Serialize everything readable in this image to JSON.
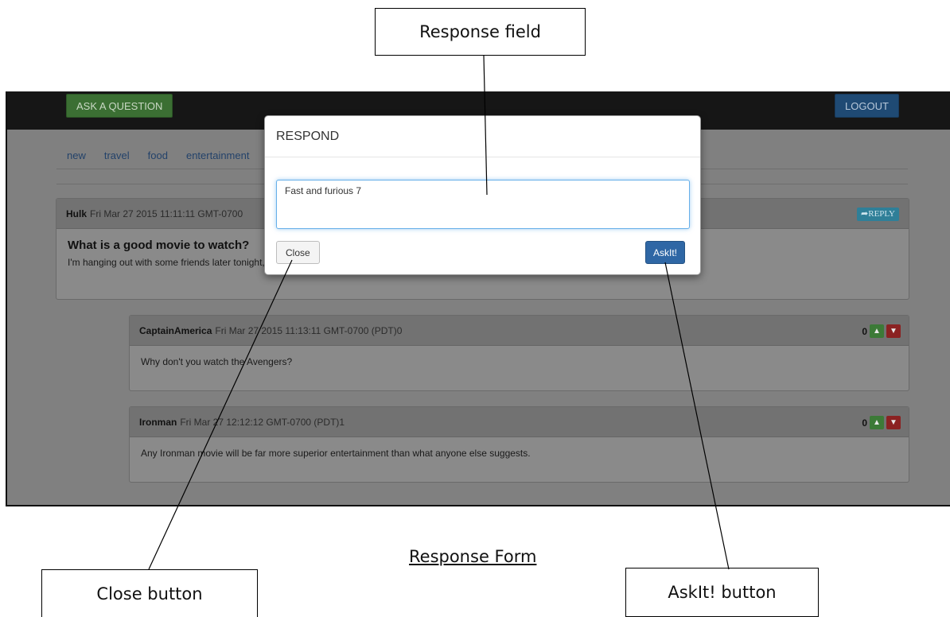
{
  "annotations": {
    "response_field": "Response field",
    "close_button": "Close button",
    "askit_button": "AskIt! button",
    "caption": "Response Form"
  },
  "navbar": {
    "ask_label": "ASK A QUESTION",
    "logout_label": "LOGOUT"
  },
  "categories": [
    "new",
    "travel",
    "food",
    "entertainment"
  ],
  "question": {
    "author": "Hulk",
    "timestamp": "Fri Mar 27 2015 11:11:11 GMT-0700",
    "reply_label": "REPLY",
    "title": "What is a good movie to watch?",
    "body": "I'm hanging out with some friends later tonight, what is a good entertaining action movie to watch?"
  },
  "answers": [
    {
      "author": "CaptainAmerica",
      "timestamp": "Fri Mar 27 2015 11:13:11 GMT-0700 (PDT)0",
      "votes": "0",
      "body": "Why don't you watch the Avengers?"
    },
    {
      "author": "Ironman",
      "timestamp": "Fri Mar 27 12:12:12 GMT-0700 (PDT)1",
      "votes": "0",
      "body": "Any Ironman movie will be far more superior entertainment than what anyone else suggests."
    }
  ],
  "modal": {
    "title": "RESPOND",
    "response_value": "Fast and furious 7",
    "close_label": "Close",
    "askit_label": "AskIt!"
  },
  "colors": {
    "ask_green": "#3b6f33",
    "logout_blue": "#1f4a74",
    "reply_teal": "#2f7f98",
    "askit_blue": "#2f67a5",
    "vote_up": "#3c7a37",
    "vote_down": "#8b2222"
  }
}
